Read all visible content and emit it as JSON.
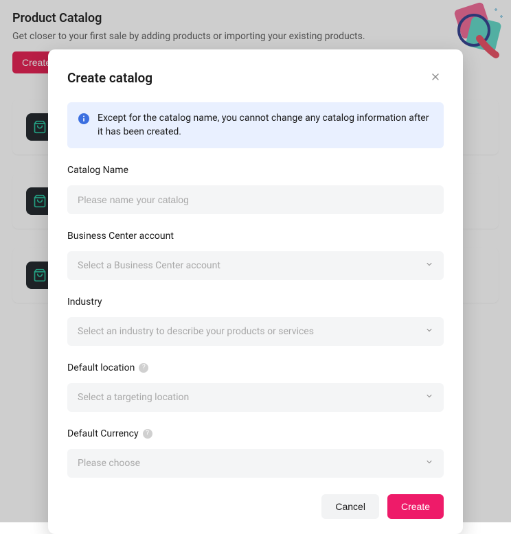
{
  "bg": {
    "title": "Product Catalog",
    "subtitle": "Get closer to your first sale by adding products or importing your existing products.",
    "create_label": "Create"
  },
  "modal": {
    "title": "Create catalog",
    "info": "Except for the catalog name, you cannot change any catalog information after it has been created.",
    "fields": {
      "catalog_name": {
        "label": "Catalog Name",
        "placeholder": "Please name your catalog"
      },
      "bc_account": {
        "label": "Business Center account",
        "placeholder": "Select a Business Center account"
      },
      "industry": {
        "label": "Industry",
        "placeholder": "Select an industry to describe your products or services"
      },
      "location": {
        "label": "Default location",
        "placeholder": "Select a targeting location"
      },
      "currency": {
        "label": "Default Currency",
        "placeholder": "Please choose"
      }
    },
    "buttons": {
      "cancel": "Cancel",
      "create": "Create"
    }
  }
}
